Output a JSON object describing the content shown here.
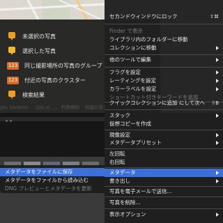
{
  "colors": {
    "accent": "#3b6fd9",
    "pin_orange": "#f0a020",
    "badge_red": "#d96b2a"
  },
  "legend": {
    "items": [
      {
        "label": "未選択の写真",
        "marker": "pin"
      },
      {
        "label": "選択した写真",
        "marker": "pin"
      },
      {
        "label": "同じ撮影場所の写真のグループ",
        "marker": "badge",
        "badge": "123"
      },
      {
        "label": "付近の写真のクラスター",
        "marker": "badge",
        "badge": "123"
      },
      {
        "label": "検索結果",
        "marker": "pin"
      }
    ]
  },
  "map_status": {
    "attribution": "gle, bänbom",
    "scale": "500 m",
    "terms": "利用規約",
    "error": "地図の誤りを報告"
  },
  "filmstrip_submenu": {
    "items": [
      {
        "label": "メタデータをファイルに保存",
        "state": "selected"
      },
      {
        "label": "メタデータをファイルから読み込む",
        "state": "normal"
      },
      {
        "label": "DNG プレビューとメタデータを更新",
        "state": "disabled"
      }
    ]
  },
  "context_menu": {
    "items": [
      {
        "label": "セカンドウィンドウにロック",
        "shortcut": "⇧⌘",
        "state": "normal"
      },
      {
        "label": "Finder で表示",
        "state": "disabled"
      },
      {
        "label": "ライブラリ内のフォルダーに移動",
        "state": "normal"
      },
      {
        "label": "コレクションに移動",
        "state": "normal",
        "submenu": true
      },
      {
        "label": "他のツールで編集",
        "state": "normal",
        "submenu": true
      },
      {
        "label": "フラグを設定",
        "state": "normal",
        "submenu": true
      },
      {
        "label": "レーティングを設定",
        "state": "normal",
        "submenu": true
      },
      {
        "label": "カラーラベルを設定",
        "state": "normal",
        "submenu": true
      },
      {
        "label": "ショートカット付きキーワードを追加",
        "state": "disabled"
      },
      {
        "label": "クイックコレクションに追加 にして次へ",
        "shortcut": "⇧B",
        "state": "normal"
      },
      {
        "label": "スタック",
        "state": "normal",
        "submenu": true
      },
      {
        "label": "仮想コピーを作成",
        "state": "normal"
      },
      {
        "label": "現像設定",
        "state": "normal",
        "submenu": true
      },
      {
        "label": "メタデータプリセット",
        "state": "normal",
        "submenu": true
      },
      {
        "label": "左回転",
        "state": "normal"
      },
      {
        "label": "右回転",
        "state": "normal"
      },
      {
        "label": "メタデータ",
        "state": "selected",
        "submenu": true
      },
      {
        "label": "書き出し",
        "state": "normal",
        "submenu": true
      },
      {
        "label": "写真を電子メールで送信...",
        "state": "normal"
      },
      {
        "label": "写真を削除...",
        "state": "normal"
      },
      {
        "label": "表示オプション",
        "state": "normal",
        "submenu": true
      }
    ]
  }
}
